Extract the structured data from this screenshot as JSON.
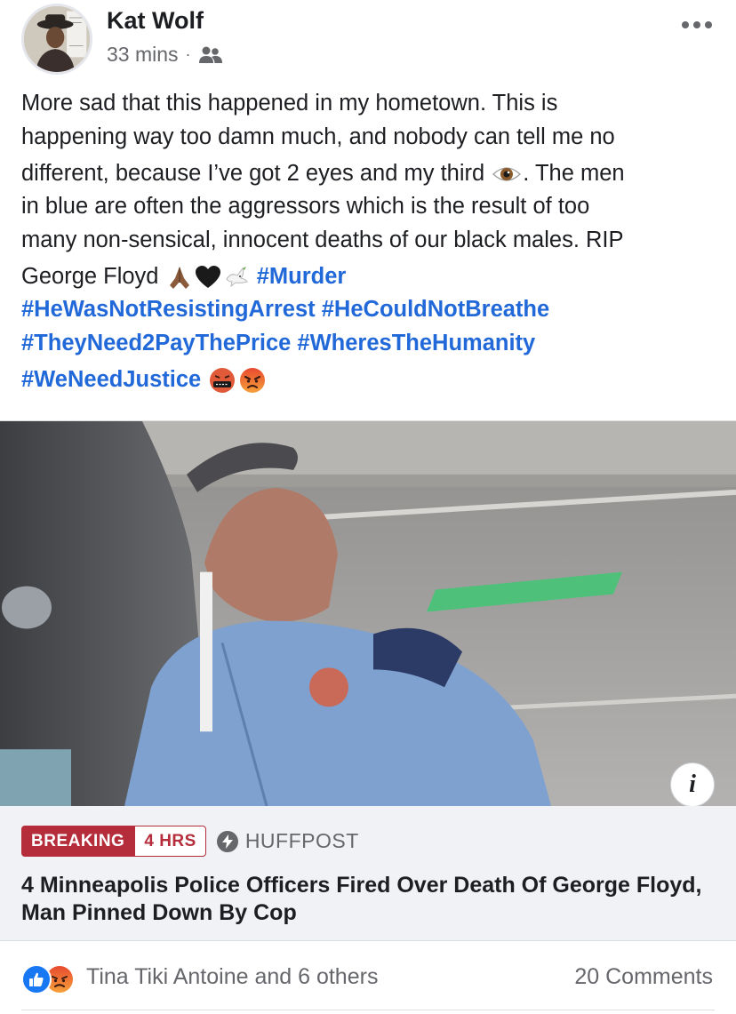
{
  "post": {
    "author": "Kat Wolf",
    "timestamp": "33 mins",
    "separator": "·",
    "audience_icon": "friends-icon",
    "menu_icon": "more-horizontal-icon",
    "text": {
      "line1": "More sad that this happened in my hometown. This is",
      "line2": "happening way too damn much, and nobody can tell me no",
      "line3a": "different, because I’ve got 2 eyes and my third",
      "line3b": ". The men",
      "line4": "in blue are often the aggressors which is the result of too",
      "line5": "many non-sensical, innocent deaths of our black males. RIP",
      "line6": "George Floyd"
    },
    "hashtags": {
      "murder": "#Murder",
      "not_resisting": "#HeWasNotResistingArrest",
      "not_breathe": "#HeCouldNotBreathe",
      "pay_price": "#TheyNeed2PayThePrice",
      "humanity": "#WheresTheHumanity",
      "justice": "#WeNeedJustice"
    },
    "emojis": [
      "eye",
      "folded-hands",
      "black-heart",
      "dove",
      "face-with-symbols",
      "angry-face"
    ]
  },
  "link_card": {
    "info_label": "i",
    "badge_breaking": "BREAKING",
    "badge_time": "4 HRS",
    "source": "HUFFPOST",
    "headline": "4 Minneapolis Police Officers Fired Over Death Of George Floyd, Man Pinned Down By Cop"
  },
  "engagement": {
    "reaction_types": [
      "like",
      "angry"
    ],
    "reactors": "Tina Tiki Antoine and 6 others",
    "comments": "20 Comments"
  },
  "colors": {
    "hashtag": "#2168d8",
    "breaking": "#b52d3a",
    "secondary_text": "#65676b",
    "like": "#1877f2"
  }
}
